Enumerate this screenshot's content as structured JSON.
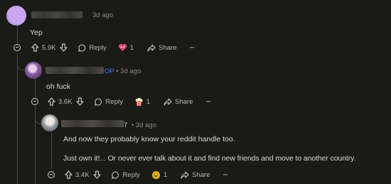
{
  "comments": [
    {
      "time": "3d ago",
      "body": [
        "Yep"
      ],
      "score": "5.9K",
      "reply_label": "Reply",
      "award_count": "1",
      "share_label": "Share",
      "more_label": "···"
    },
    {
      "op_tag": "OP",
      "time": "• 3d ago",
      "body": [
        "oh fuck"
      ],
      "score": "3.6K",
      "reply_label": "Reply",
      "award_count": "1",
      "share_label": "Share",
      "more_label": "···"
    },
    {
      "user_suffix": "7",
      "time": "• 3d ago",
      "body": [
        "And now they probably know your reddit handle too.",
        "Just own it!... Or never ever talk about it and find new friends and move to another country."
      ],
      "score": "3.4K",
      "reply_label": "Reply",
      "award_count": "1",
      "share_label": "Share",
      "more_label": "···"
    }
  ],
  "colors": {
    "background": "#1a1a16",
    "op_blue": "#4a7cf0",
    "award_pink": "#e0457b",
    "award_gold": "#f2b705"
  }
}
